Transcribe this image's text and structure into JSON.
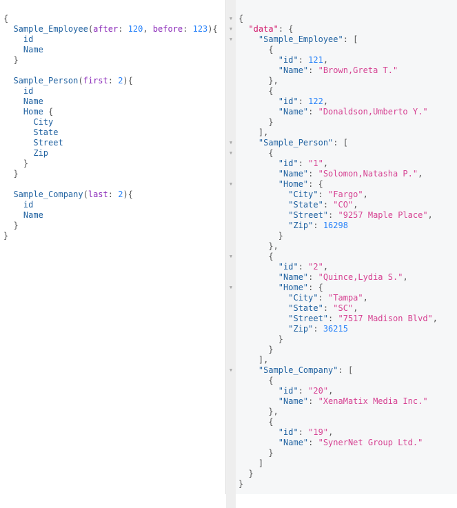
{
  "query_editor": {
    "lines": [
      [
        {
          "t": "{",
          "c": "punc"
        }
      ],
      [
        {
          "t": "  "
        },
        {
          "t": "Sample_Employee",
          "c": "def"
        },
        {
          "t": "(",
          "c": "punc"
        },
        {
          "t": "after",
          "c": "arg"
        },
        {
          "t": ": ",
          "c": "punc"
        },
        {
          "t": "120",
          "c": "num"
        },
        {
          "t": ", ",
          "c": "punc"
        },
        {
          "t": "before",
          "c": "arg"
        },
        {
          "t": ": ",
          "c": "punc"
        },
        {
          "t": "123",
          "c": "num"
        },
        {
          "t": "){",
          "c": "punc"
        }
      ],
      [
        {
          "t": "    "
        },
        {
          "t": "id",
          "c": "q-field"
        }
      ],
      [
        {
          "t": "    "
        },
        {
          "t": "Name",
          "c": "q-field"
        }
      ],
      [
        {
          "t": "  "
        },
        {
          "t": "}",
          "c": "punc"
        }
      ],
      [
        {
          "t": ""
        }
      ],
      [
        {
          "t": "  "
        },
        {
          "t": "Sample_Person",
          "c": "def"
        },
        {
          "t": "(",
          "c": "punc"
        },
        {
          "t": "first",
          "c": "arg"
        },
        {
          "t": ": ",
          "c": "punc"
        },
        {
          "t": "2",
          "c": "num"
        },
        {
          "t": "){",
          "c": "punc"
        }
      ],
      [
        {
          "t": "    "
        },
        {
          "t": "id",
          "c": "q-field"
        }
      ],
      [
        {
          "t": "    "
        },
        {
          "t": "Name",
          "c": "q-field"
        }
      ],
      [
        {
          "t": "    "
        },
        {
          "t": "Home",
          "c": "q-field"
        },
        {
          "t": " {",
          "c": "punc"
        }
      ],
      [
        {
          "t": "      "
        },
        {
          "t": "City",
          "c": "q-field"
        }
      ],
      [
        {
          "t": "      "
        },
        {
          "t": "State",
          "c": "q-field"
        }
      ],
      [
        {
          "t": "      "
        },
        {
          "t": "Street",
          "c": "q-field"
        }
      ],
      [
        {
          "t": "      "
        },
        {
          "t": "Zip",
          "c": "q-field"
        }
      ],
      [
        {
          "t": "    "
        },
        {
          "t": "}",
          "c": "punc"
        }
      ],
      [
        {
          "t": "  "
        },
        {
          "t": "}",
          "c": "punc"
        }
      ],
      [
        {
          "t": ""
        }
      ],
      [
        {
          "t": "  "
        },
        {
          "t": "Sample_Company",
          "c": "def"
        },
        {
          "t": "(",
          "c": "punc"
        },
        {
          "t": "last",
          "c": "arg"
        },
        {
          "t": ": ",
          "c": "punc"
        },
        {
          "t": "2",
          "c": "num"
        },
        {
          "t": "){",
          "c": "punc"
        }
      ],
      [
        {
          "t": "    "
        },
        {
          "t": "id",
          "c": "q-field"
        }
      ],
      [
        {
          "t": "    "
        },
        {
          "t": "Name",
          "c": "q-field"
        }
      ],
      [
        {
          "t": "  "
        },
        {
          "t": "}",
          "c": "punc"
        }
      ],
      [
        {
          "t": "}",
          "c": "punc"
        }
      ]
    ]
  },
  "result_viewer": {
    "fold_icon": "▼",
    "lines": [
      {
        "fold": true,
        "parts": [
          {
            "t": "{",
            "c": "punc"
          }
        ]
      },
      {
        "fold": true,
        "parts": [
          {
            "t": "  "
          },
          {
            "t": "\"data\"",
            "c": "datakey"
          },
          {
            "t": ": {",
            "c": "punc"
          }
        ]
      },
      {
        "fold": true,
        "parts": [
          {
            "t": "    "
          },
          {
            "t": "\"Sample_Employee\"",
            "c": "key"
          },
          {
            "t": ": [",
            "c": "punc"
          }
        ]
      },
      {
        "fold": false,
        "parts": [
          {
            "t": "      "
          },
          {
            "t": "{",
            "c": "punc"
          }
        ]
      },
      {
        "fold": false,
        "parts": [
          {
            "t": "        "
          },
          {
            "t": "\"id\"",
            "c": "key"
          },
          {
            "t": ": ",
            "c": "punc"
          },
          {
            "t": "121",
            "c": "jnum"
          },
          {
            "t": ",",
            "c": "punc"
          }
        ]
      },
      {
        "fold": false,
        "parts": [
          {
            "t": "        "
          },
          {
            "t": "\"Name\"",
            "c": "key"
          },
          {
            "t": ": ",
            "c": "punc"
          },
          {
            "t": "\"Brown,Greta T.\"",
            "c": "str"
          }
        ]
      },
      {
        "fold": false,
        "parts": [
          {
            "t": "      "
          },
          {
            "t": "},",
            "c": "punc"
          }
        ]
      },
      {
        "fold": false,
        "parts": [
          {
            "t": "      "
          },
          {
            "t": "{",
            "c": "punc"
          }
        ]
      },
      {
        "fold": false,
        "parts": [
          {
            "t": "        "
          },
          {
            "t": "\"id\"",
            "c": "key"
          },
          {
            "t": ": ",
            "c": "punc"
          },
          {
            "t": "122",
            "c": "jnum"
          },
          {
            "t": ",",
            "c": "punc"
          }
        ]
      },
      {
        "fold": false,
        "parts": [
          {
            "t": "        "
          },
          {
            "t": "\"Name\"",
            "c": "key"
          },
          {
            "t": ": ",
            "c": "punc"
          },
          {
            "t": "\"Donaldson,Umberto Y.\"",
            "c": "str"
          }
        ]
      },
      {
        "fold": false,
        "parts": [
          {
            "t": "      "
          },
          {
            "t": "}",
            "c": "punc"
          }
        ]
      },
      {
        "fold": false,
        "parts": [
          {
            "t": "    "
          },
          {
            "t": "],",
            "c": "punc"
          }
        ]
      },
      {
        "fold": true,
        "parts": [
          {
            "t": "    "
          },
          {
            "t": "\"Sample_Person\"",
            "c": "key"
          },
          {
            "t": ": [",
            "c": "punc"
          }
        ]
      },
      {
        "fold": true,
        "parts": [
          {
            "t": "      "
          },
          {
            "t": "{",
            "c": "punc"
          }
        ]
      },
      {
        "fold": false,
        "parts": [
          {
            "t": "        "
          },
          {
            "t": "\"id\"",
            "c": "key"
          },
          {
            "t": ": ",
            "c": "punc"
          },
          {
            "t": "\"1\"",
            "c": "str"
          },
          {
            "t": ",",
            "c": "punc"
          }
        ]
      },
      {
        "fold": false,
        "parts": [
          {
            "t": "        "
          },
          {
            "t": "\"Name\"",
            "c": "key"
          },
          {
            "t": ": ",
            "c": "punc"
          },
          {
            "t": "\"Solomon,Natasha P.\"",
            "c": "str"
          },
          {
            "t": ",",
            "c": "punc"
          }
        ]
      },
      {
        "fold": true,
        "parts": [
          {
            "t": "        "
          },
          {
            "t": "\"Home\"",
            "c": "key"
          },
          {
            "t": ": {",
            "c": "punc"
          }
        ]
      },
      {
        "fold": false,
        "parts": [
          {
            "t": "          "
          },
          {
            "t": "\"City\"",
            "c": "key"
          },
          {
            "t": ": ",
            "c": "punc"
          },
          {
            "t": "\"Fargo\"",
            "c": "str"
          },
          {
            "t": ",",
            "c": "punc"
          }
        ]
      },
      {
        "fold": false,
        "parts": [
          {
            "t": "          "
          },
          {
            "t": "\"State\"",
            "c": "key"
          },
          {
            "t": ": ",
            "c": "punc"
          },
          {
            "t": "\"CO\"",
            "c": "str"
          },
          {
            "t": ",",
            "c": "punc"
          }
        ]
      },
      {
        "fold": false,
        "parts": [
          {
            "t": "          "
          },
          {
            "t": "\"Street\"",
            "c": "key"
          },
          {
            "t": ": ",
            "c": "punc"
          },
          {
            "t": "\"9257 Maple Place\"",
            "c": "str"
          },
          {
            "t": ",",
            "c": "punc"
          }
        ]
      },
      {
        "fold": false,
        "parts": [
          {
            "t": "          "
          },
          {
            "t": "\"Zip\"",
            "c": "key"
          },
          {
            "t": ": ",
            "c": "punc"
          },
          {
            "t": "16298",
            "c": "jnum"
          }
        ]
      },
      {
        "fold": false,
        "parts": [
          {
            "t": "        "
          },
          {
            "t": "}",
            "c": "punc"
          }
        ]
      },
      {
        "fold": false,
        "parts": [
          {
            "t": "      "
          },
          {
            "t": "},",
            "c": "punc"
          }
        ]
      },
      {
        "fold": true,
        "parts": [
          {
            "t": "      "
          },
          {
            "t": "{",
            "c": "punc"
          }
        ]
      },
      {
        "fold": false,
        "parts": [
          {
            "t": "        "
          },
          {
            "t": "\"id\"",
            "c": "key"
          },
          {
            "t": ": ",
            "c": "punc"
          },
          {
            "t": "\"2\"",
            "c": "str"
          },
          {
            "t": ",",
            "c": "punc"
          }
        ]
      },
      {
        "fold": false,
        "parts": [
          {
            "t": "        "
          },
          {
            "t": "\"Name\"",
            "c": "key"
          },
          {
            "t": ": ",
            "c": "punc"
          },
          {
            "t": "\"Quince,Lydia S.\"",
            "c": "str"
          },
          {
            "t": ",",
            "c": "punc"
          }
        ]
      },
      {
        "fold": true,
        "parts": [
          {
            "t": "        "
          },
          {
            "t": "\"Home\"",
            "c": "key"
          },
          {
            "t": ": {",
            "c": "punc"
          }
        ]
      },
      {
        "fold": false,
        "parts": [
          {
            "t": "          "
          },
          {
            "t": "\"City\"",
            "c": "key"
          },
          {
            "t": ": ",
            "c": "punc"
          },
          {
            "t": "\"Tampa\"",
            "c": "str"
          },
          {
            "t": ",",
            "c": "punc"
          }
        ]
      },
      {
        "fold": false,
        "parts": [
          {
            "t": "          "
          },
          {
            "t": "\"State\"",
            "c": "key"
          },
          {
            "t": ": ",
            "c": "punc"
          },
          {
            "t": "\"SC\"",
            "c": "str"
          },
          {
            "t": ",",
            "c": "punc"
          }
        ]
      },
      {
        "fold": false,
        "parts": [
          {
            "t": "          "
          },
          {
            "t": "\"Street\"",
            "c": "key"
          },
          {
            "t": ": ",
            "c": "punc"
          },
          {
            "t": "\"7517 Madison Blvd\"",
            "c": "str"
          },
          {
            "t": ",",
            "c": "punc"
          }
        ]
      },
      {
        "fold": false,
        "parts": [
          {
            "t": "          "
          },
          {
            "t": "\"Zip\"",
            "c": "key"
          },
          {
            "t": ": ",
            "c": "punc"
          },
          {
            "t": "36215",
            "c": "jnum"
          }
        ]
      },
      {
        "fold": false,
        "parts": [
          {
            "t": "        "
          },
          {
            "t": "}",
            "c": "punc"
          }
        ]
      },
      {
        "fold": false,
        "parts": [
          {
            "t": "      "
          },
          {
            "t": "}",
            "c": "punc"
          }
        ]
      },
      {
        "fold": false,
        "parts": [
          {
            "t": "    "
          },
          {
            "t": "],",
            "c": "punc"
          }
        ]
      },
      {
        "fold": true,
        "parts": [
          {
            "t": "    "
          },
          {
            "t": "\"Sample_Company\"",
            "c": "key"
          },
          {
            "t": ": [",
            "c": "punc"
          }
        ]
      },
      {
        "fold": false,
        "parts": [
          {
            "t": "      "
          },
          {
            "t": "{",
            "c": "punc"
          }
        ]
      },
      {
        "fold": false,
        "parts": [
          {
            "t": "        "
          },
          {
            "t": "\"id\"",
            "c": "key"
          },
          {
            "t": ": ",
            "c": "punc"
          },
          {
            "t": "\"20\"",
            "c": "str"
          },
          {
            "t": ",",
            "c": "punc"
          }
        ]
      },
      {
        "fold": false,
        "parts": [
          {
            "t": "        "
          },
          {
            "t": "\"Name\"",
            "c": "key"
          },
          {
            "t": ": ",
            "c": "punc"
          },
          {
            "t": "\"XenaMatix Media Inc.\"",
            "c": "str"
          }
        ]
      },
      {
        "fold": false,
        "parts": [
          {
            "t": "      "
          },
          {
            "t": "},",
            "c": "punc"
          }
        ]
      },
      {
        "fold": false,
        "parts": [
          {
            "t": "      "
          },
          {
            "t": "{",
            "c": "punc"
          }
        ]
      },
      {
        "fold": false,
        "parts": [
          {
            "t": "        "
          },
          {
            "t": "\"id\"",
            "c": "key"
          },
          {
            "t": ": ",
            "c": "punc"
          },
          {
            "t": "\"19\"",
            "c": "str"
          },
          {
            "t": ",",
            "c": "punc"
          }
        ]
      },
      {
        "fold": false,
        "parts": [
          {
            "t": "        "
          },
          {
            "t": "\"Name\"",
            "c": "key"
          },
          {
            "t": ": ",
            "c": "punc"
          },
          {
            "t": "\"SynerNet Group Ltd.\"",
            "c": "str"
          }
        ]
      },
      {
        "fold": false,
        "parts": [
          {
            "t": "      "
          },
          {
            "t": "}",
            "c": "punc"
          }
        ]
      },
      {
        "fold": false,
        "parts": [
          {
            "t": "    "
          },
          {
            "t": "]",
            "c": "punc"
          }
        ]
      },
      {
        "fold": false,
        "parts": [
          {
            "t": "  "
          },
          {
            "t": "}",
            "c": "punc"
          }
        ]
      },
      {
        "fold": false,
        "parts": [
          {
            "t": "}",
            "c": "punc"
          }
        ]
      }
    ]
  }
}
